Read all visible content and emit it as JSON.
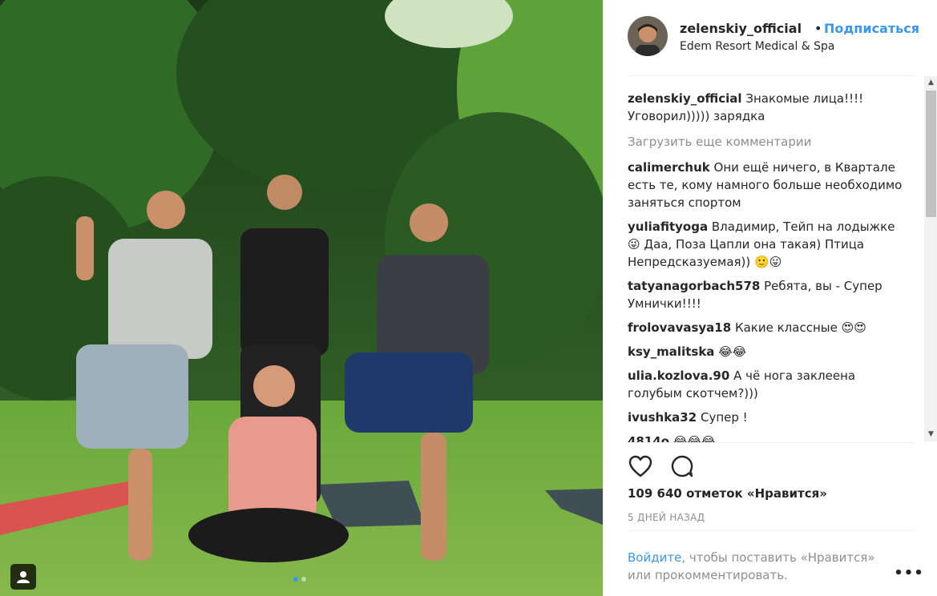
{
  "post": {
    "username": "zelenskiy_official",
    "separator": "•",
    "follow_label": "Подписаться",
    "location": "Edem Resort Medical & Spa"
  },
  "caption": {
    "user": "zelenskiy_official",
    "text": "Знакомые лица!!!! Уговорил))))) зарядка"
  },
  "load_more_label": "Загрузить еще комментарии",
  "comments": [
    {
      "user": "calimerchuk",
      "text": "Они ещё ничего, в Квартале есть те, кому намного больше необходимо заняться спортом"
    },
    {
      "user": "yuliafityoga",
      "text": "Владимир, Тейп на лодыжке 😜 Даа, Поза Цапли она такая) Птица Непредсказуемая)) 🙂😛"
    },
    {
      "user": "tatyanagorbach578",
      "text": "Ребята, вы - Супер Умнички!!!!"
    },
    {
      "user": "frolovavasya18",
      "text": "Какие классные 😍😍"
    },
    {
      "user": "ksy_malitska",
      "text": "😂😂"
    },
    {
      "user": "ulia.kozlova.90",
      "text": "А чё нога заклеена голубым скотчем?)))"
    },
    {
      "user": "ivushka32",
      "text": "Супер !"
    },
    {
      "user": "4814o",
      "text": "😂😂😂"
    }
  ],
  "icons": {
    "like": "heart-icon",
    "comment": "comment-icon",
    "tag": "person-tag-icon",
    "more": "more-options-icon"
  },
  "likes_text": "109 640 отметок «Нравится»",
  "date_text": "5 ДНЕЙ НАЗАД",
  "login_prompt": {
    "link": "Войдите",
    "rest": ", чтобы поставить «Нравится» или прокомментировать."
  },
  "more_label": "•••",
  "colors": {
    "accent": "#3897f0",
    "text": "#262626",
    "muted": "#8e8e8e"
  }
}
